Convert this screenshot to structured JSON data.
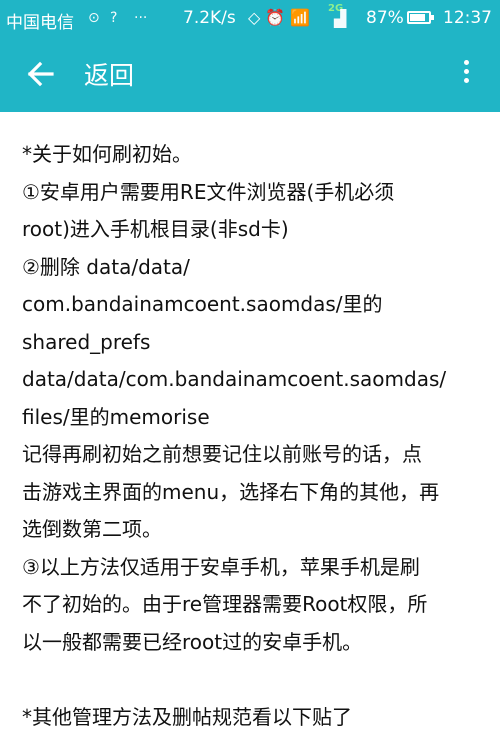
{
  "status_bar": {
    "carrier": "中国电信",
    "speed": "7.2K/s",
    "network_badge": "2G",
    "battery_percent": "87%",
    "battery_level": 0.87,
    "time": "12:37",
    "icons": [
      "alarm-icon",
      "wifi-icon",
      "signal-icon",
      "battery-icon",
      "sync-icon",
      "more-dots-icon"
    ]
  },
  "app_bar": {
    "title": "返回",
    "back_icon": "arrow-left-icon",
    "menu_icon": "more-vert-icon"
  },
  "article": {
    "lines": [
      "*关于如何刷初始。",
      "①安卓用户需要用RE文件浏览器(手机必须",
      "root)进入手机根目录(非sd卡)",
      "②删除 data/data/",
      "com.bandainamcoent.saomdas/里的",
      "shared_prefs",
      "data/data/com.bandainamcoent.saomdas/",
      "files/里的memorise",
      "记得再刷初始之前想要记住以前账号的话，点",
      "击游戏主界面的menu，选择右下角的其他，再",
      "选倒数第二项。",
      "③以上方法仅适用于安卓手机，苹果手机是刷",
      "不了初始的。由于re管理器需要Root权限，所",
      "以一般都需要已经root过的安卓手机。",
      "",
      "*其他管理方法及删帖规范看以下贴了"
    ]
  }
}
